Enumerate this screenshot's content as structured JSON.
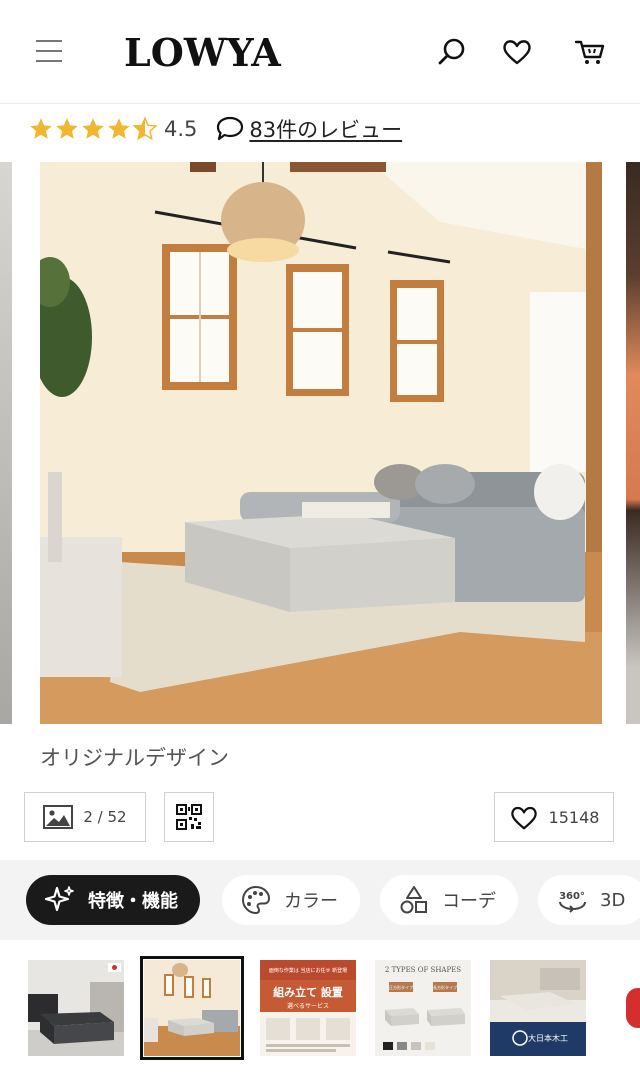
{
  "header": {
    "logo": "LOWYA",
    "icons": [
      "menu-icon",
      "search-icon",
      "heart-icon",
      "cart-icon"
    ]
  },
  "rating": {
    "value": "4.5",
    "stars": 4.5,
    "review_link": "83件のレビュー"
  },
  "gallery": {
    "caption": "オリジナルデザイン",
    "image_count": "2 / 52",
    "favorite_count": "15148"
  },
  "tabs": [
    {
      "label": "特徴・機能",
      "icon": "sparkle-icon",
      "active": true
    },
    {
      "label": "カラー",
      "icon": "palette-icon",
      "active": false
    },
    {
      "label": "コーデ",
      "icon": "shapes-icon",
      "active": false
    },
    {
      "label": "3D",
      "icon": "rotate-360-icon",
      "active": false
    },
    {
      "label_360": "360°"
    }
  ],
  "thumbnails": {
    "t3": {
      "top_note": "面倒な作業は 当店にお任せ 新登場",
      "title": "組み立て 設置",
      "sub": "選べるサービス"
    },
    "t4": {
      "title": "2 TYPES OF SHAPES",
      "left": "正方形タイプ",
      "right": "長方形タイプ"
    },
    "t5": {
      "label": "大日本木工"
    }
  },
  "colors": {
    "star": "#f0b730",
    "active_tab": "#1a1a1a",
    "accent_red": "#d32f2f"
  }
}
